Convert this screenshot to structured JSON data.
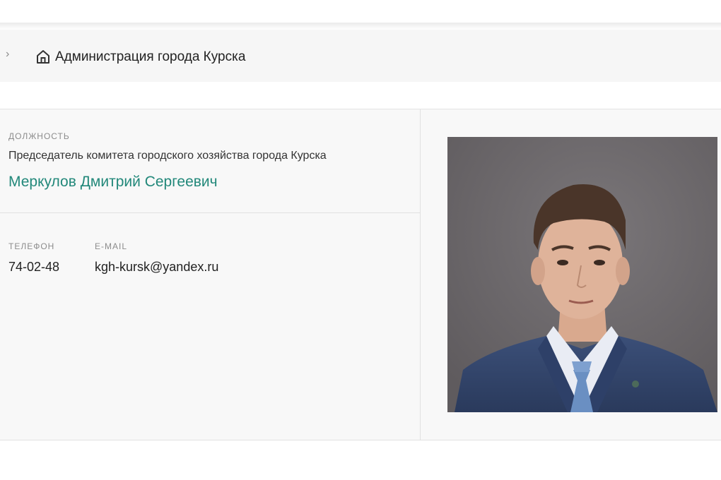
{
  "breadcrumb": {
    "chevron_icon": "chevron-right-icon",
    "home_icon": "home-icon",
    "title": "Администрация города Курска"
  },
  "profile": {
    "position_label": "ДОЛЖНОСТЬ",
    "position": "Председатель комитета городского хозяйства города Курска",
    "name": "Меркулов Дмитрий Сергеевич",
    "phone_label": "ТЕЛЕФОН",
    "phone": "74-02-48",
    "email_label": "E-MAIL",
    "email": "kgh-kursk@yandex.ru",
    "name_color": "#22887a"
  },
  "photo": {
    "background_color": "#6f6b6d"
  }
}
